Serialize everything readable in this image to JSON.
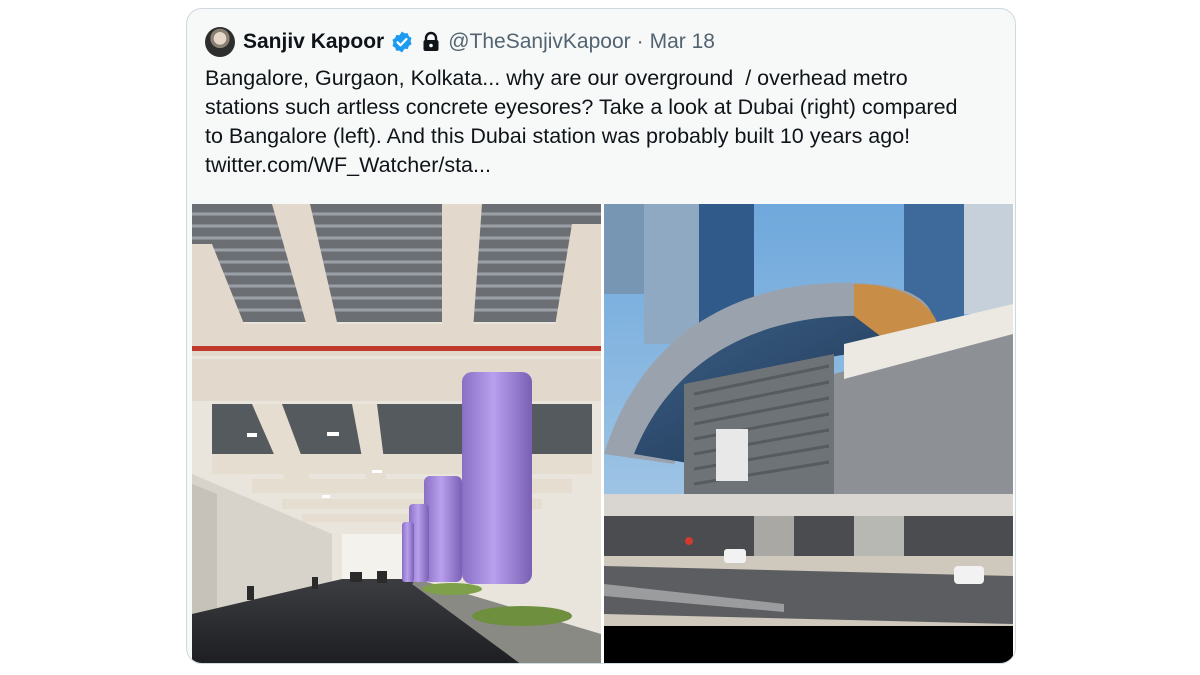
{
  "tweet": {
    "author_name": "Sanjiv Kapoor",
    "handle": "@TheSanjivKapoor",
    "separator": "·",
    "date": "Mar 18",
    "text_lines": [
      "Bangalore, Gurgaon, Kolkata... why are our overground  / overhead metro",
      "stations such artless concrete eyesores? Take a look at Dubai (right) compared",
      "to Bangalore (left). And this Dubai station was probably built 10 years ago!",
      "twitter.com/WF_Watcher/sta..."
    ],
    "icons": {
      "verified": "verified-badge-icon",
      "protected": "lock-icon"
    },
    "colors": {
      "verified": "#1d9bf0",
      "text": "#0f1419",
      "muted": "#536471",
      "card_bg": "#f7f9f9",
      "border": "#cfd9de",
      "pillar": "#a98ce0"
    },
    "media": {
      "left_photo": "Bangalore overhead metro underside with purple pillars",
      "right_photo": "Dubai metro station with curved glass roof"
    }
  }
}
